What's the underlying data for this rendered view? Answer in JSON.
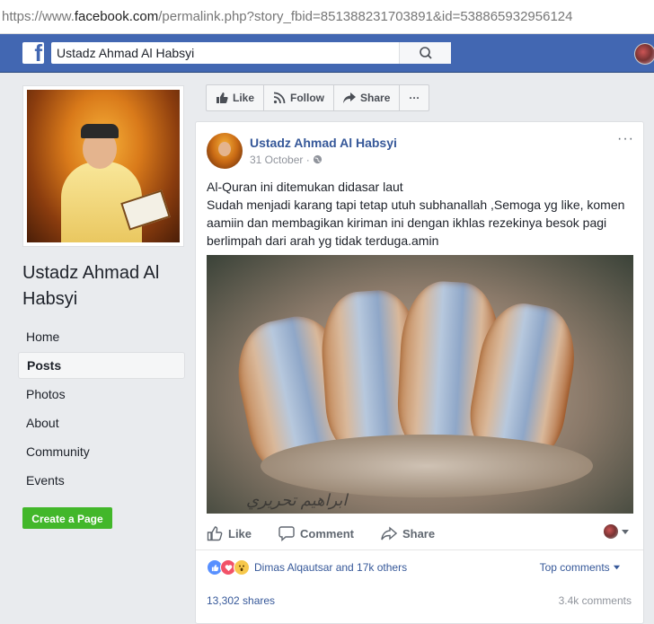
{
  "browser": {
    "url_prefix": "https://www.",
    "url_host": "facebook.com",
    "url_path": "/permalink.php?story_fbid=851388231703891&id=538865932956124"
  },
  "topbar": {
    "logo": "f",
    "search_value": "Ustadz Ahmad Al Habsyi"
  },
  "page": {
    "name": "Ustadz Ahmad Al Habsyi",
    "nav": [
      "Home",
      "Posts",
      "Photos",
      "About",
      "Community",
      "Events"
    ],
    "active_nav": "Posts",
    "create_page_label": "Create a Page"
  },
  "actionbar": {
    "like": "Like",
    "follow": "Follow",
    "share": "Share",
    "more": "···"
  },
  "post": {
    "author": "Ustadz Ahmad Al Habsyi",
    "date": "31 October",
    "privacy_icon": "globe-icon",
    "text_line1": "Al-Quran ini ditemukan didasar laut",
    "text_line2": "Sudah menjadi karang tapi tetap utuh subhanallah ,Semoga yg like, komen aamiin dan membagikan kiriman ini dengan ikhlas rezekinya besok pagi berlimpah dari arah yg tidak terduga.amin",
    "image_watermark": "ابراهيم تحريري",
    "actions": {
      "like": "Like",
      "comment": "Comment",
      "share": "Share"
    },
    "reactions_text": "Dimas Alqautsar and 17k others",
    "top_comments": "Top comments",
    "shares": "13,302 shares",
    "comments": "3.4k comments"
  },
  "colors": {
    "fb_blue": "#4267b2",
    "link_blue": "#365899",
    "green": "#42b72a",
    "background": "#e9ebee"
  }
}
